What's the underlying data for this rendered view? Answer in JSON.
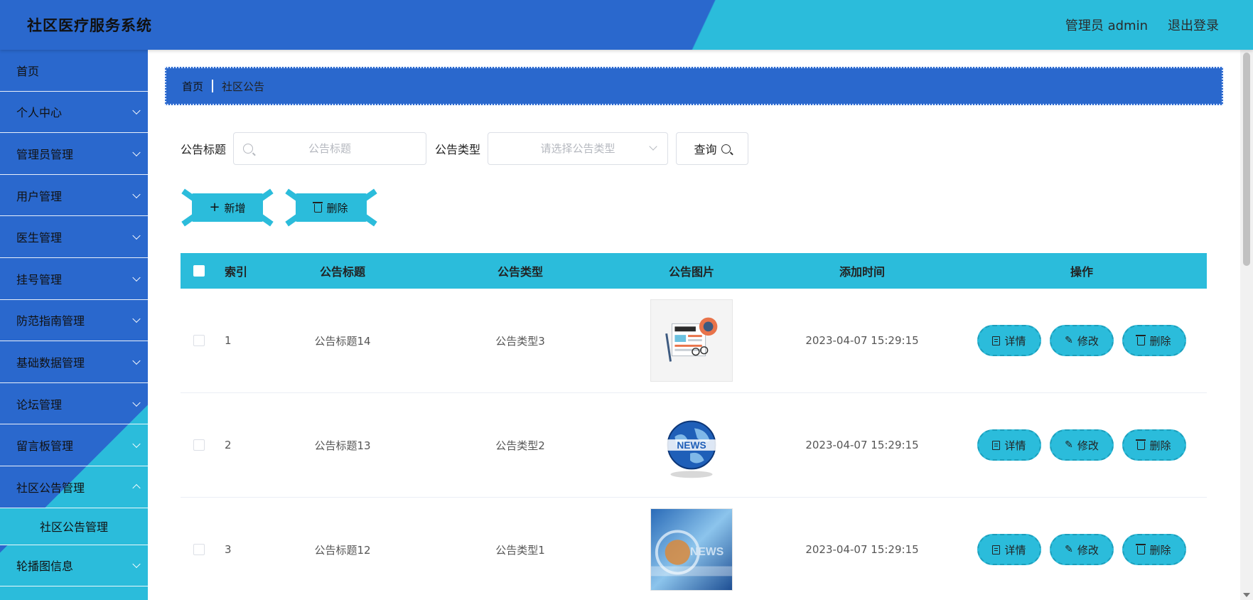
{
  "header": {
    "app_title": "社区医疗服务系统",
    "user_label": "管理员 admin",
    "logout_label": "退出登录"
  },
  "colors": {
    "primary_blue": "#2a68cd",
    "accent_cyan": "#2bbcdb"
  },
  "sidebar": {
    "items": [
      {
        "label": "首页",
        "has_children": false
      },
      {
        "label": "个人中心",
        "has_children": true
      },
      {
        "label": "管理员管理",
        "has_children": true
      },
      {
        "label": "用户管理",
        "has_children": true
      },
      {
        "label": "医生管理",
        "has_children": true
      },
      {
        "label": "挂号管理",
        "has_children": true
      },
      {
        "label": "防范指南管理",
        "has_children": true
      },
      {
        "label": "基础数据管理",
        "has_children": true
      },
      {
        "label": "论坛管理",
        "has_children": true
      },
      {
        "label": "留言板管理",
        "has_children": true
      },
      {
        "label": "社区公告管理",
        "has_children": true,
        "open": true
      },
      {
        "label": "轮播图信息",
        "has_children": true
      }
    ],
    "submenu": {
      "label": "社区公告管理"
    }
  },
  "breadcrumb": {
    "home": "首页",
    "current": "社区公告"
  },
  "search": {
    "title_label": "公告标题",
    "title_placeholder": "公告标题",
    "type_label": "公告类型",
    "type_placeholder": "请选择公告类型",
    "query_label": "查询"
  },
  "actions": {
    "add_label": "新增",
    "delete_label": "删除"
  },
  "table": {
    "columns": [
      "索引",
      "公告标题",
      "公告类型",
      "公告图片",
      "添加时间",
      "操作"
    ],
    "rows": [
      {
        "index": "1",
        "title": "公告标题14",
        "type": "公告类型3",
        "image": "news-paper-icon",
        "time": "2023-04-07 15:29:15"
      },
      {
        "index": "2",
        "title": "公告标题13",
        "type": "公告类型2",
        "image": "news-globe-icon",
        "time": "2023-04-07 15:29:15"
      },
      {
        "index": "3",
        "title": "公告标题12",
        "type": "公告类型1",
        "image": "news-banner-icon",
        "time": "2023-04-07 15:29:15"
      }
    ],
    "row_actions": {
      "detail": "详情",
      "edit": "修改",
      "delete": "删除"
    }
  }
}
